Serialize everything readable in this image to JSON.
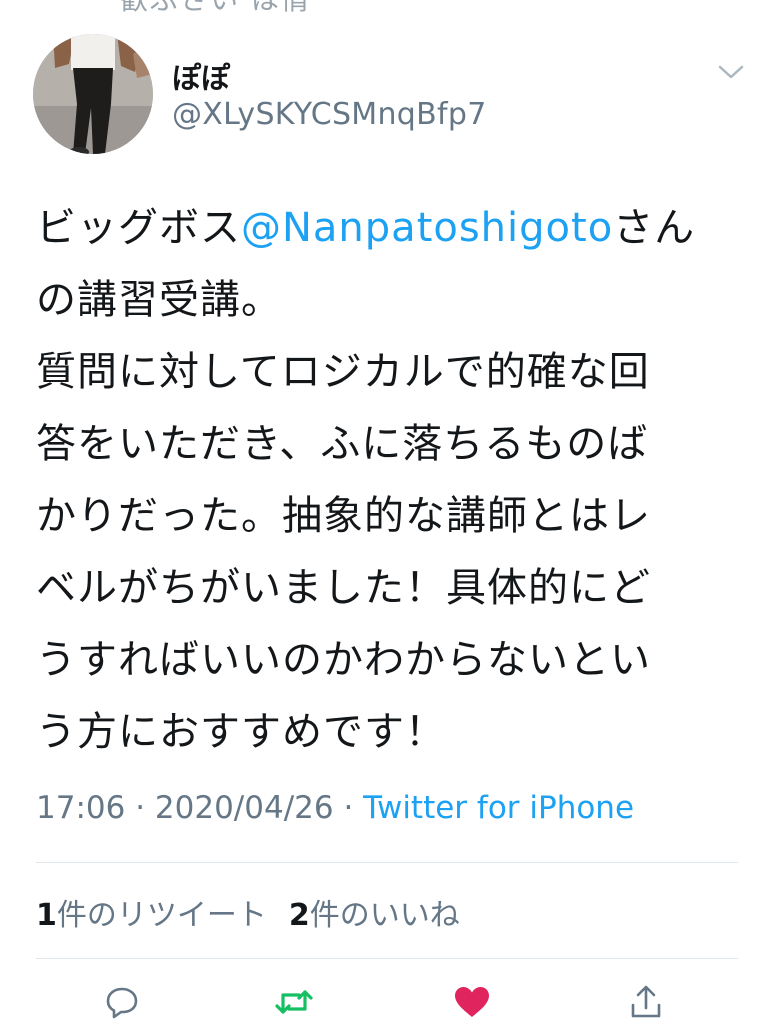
{
  "header": {
    "clipped_previous_text": "歓ぶさい は情"
  },
  "user": {
    "display_name": "ぽぽ",
    "handle": "@XLySKYCSMnqBfp7"
  },
  "tweet": {
    "line1_before": "ビッグボス",
    "line1_mention": "@Nanpatoshigoto",
    "line1_after": "さん",
    "lines": [
      "の講習受講。",
      "質問に対してロジカルで的確な回",
      "答をいただき、ふに落ちるものば",
      "かりだった。抽象的な講師とはレ",
      "ベルがちがいました！具体的にど",
      "うすればいいのかわからないとい",
      "う方におすすめです！"
    ]
  },
  "meta": {
    "time": "17:06",
    "separator": " · ",
    "date": "2020/04/26",
    "source": "Twitter for iPhone"
  },
  "stats": {
    "retweet_count": "1",
    "retweet_label": "件のリツイート",
    "like_count": "2",
    "like_label": "件のいいね"
  },
  "actions": {
    "reply_icon": "reply-icon",
    "retweet_icon": "retweet-icon",
    "like_icon": "heart-icon",
    "share_icon": "share-icon"
  },
  "colors": {
    "link_blue": "#1da1f2",
    "secondary_gray": "#657786",
    "retweet_green": "#17bf63",
    "like_red": "#e0245e"
  }
}
